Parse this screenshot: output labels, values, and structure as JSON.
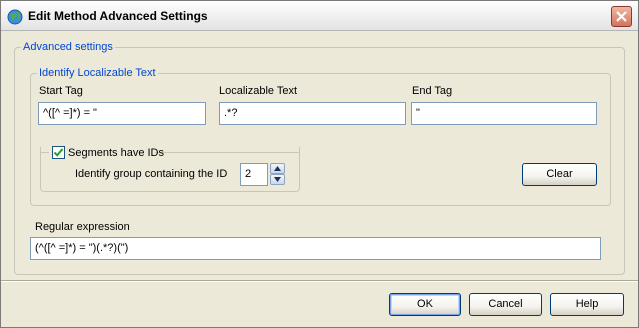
{
  "window": {
    "title": "Edit Method Advanced Settings",
    "icons": {
      "app": "globe-icon",
      "close": "close-icon"
    }
  },
  "advanced": {
    "legend": "Advanced settings",
    "identify": {
      "legend": "Identify Localizable Text",
      "start_tag": {
        "label": "Start Tag",
        "value": "^([^ =]*) = \""
      },
      "localizable": {
        "label": "Localizable Text",
        "value": ".*?"
      },
      "end_tag": {
        "label": "End Tag",
        "value": "\""
      },
      "segments": {
        "checkbox_label": "Segments have IDs",
        "checked": true,
        "group_label": "Identify group containing the ID",
        "group_value": "2"
      },
      "clear_label": "Clear"
    },
    "regex": {
      "label": "Regular expression",
      "value": "(^([^ =]*) = \")(.*?)(\")"
    }
  },
  "buttons": {
    "ok": "OK",
    "cancel": "Cancel",
    "help": "Help"
  },
  "colors": {
    "legend": "#0046d5",
    "accent_border": "#003c74",
    "checkmark": "#21a121"
  }
}
